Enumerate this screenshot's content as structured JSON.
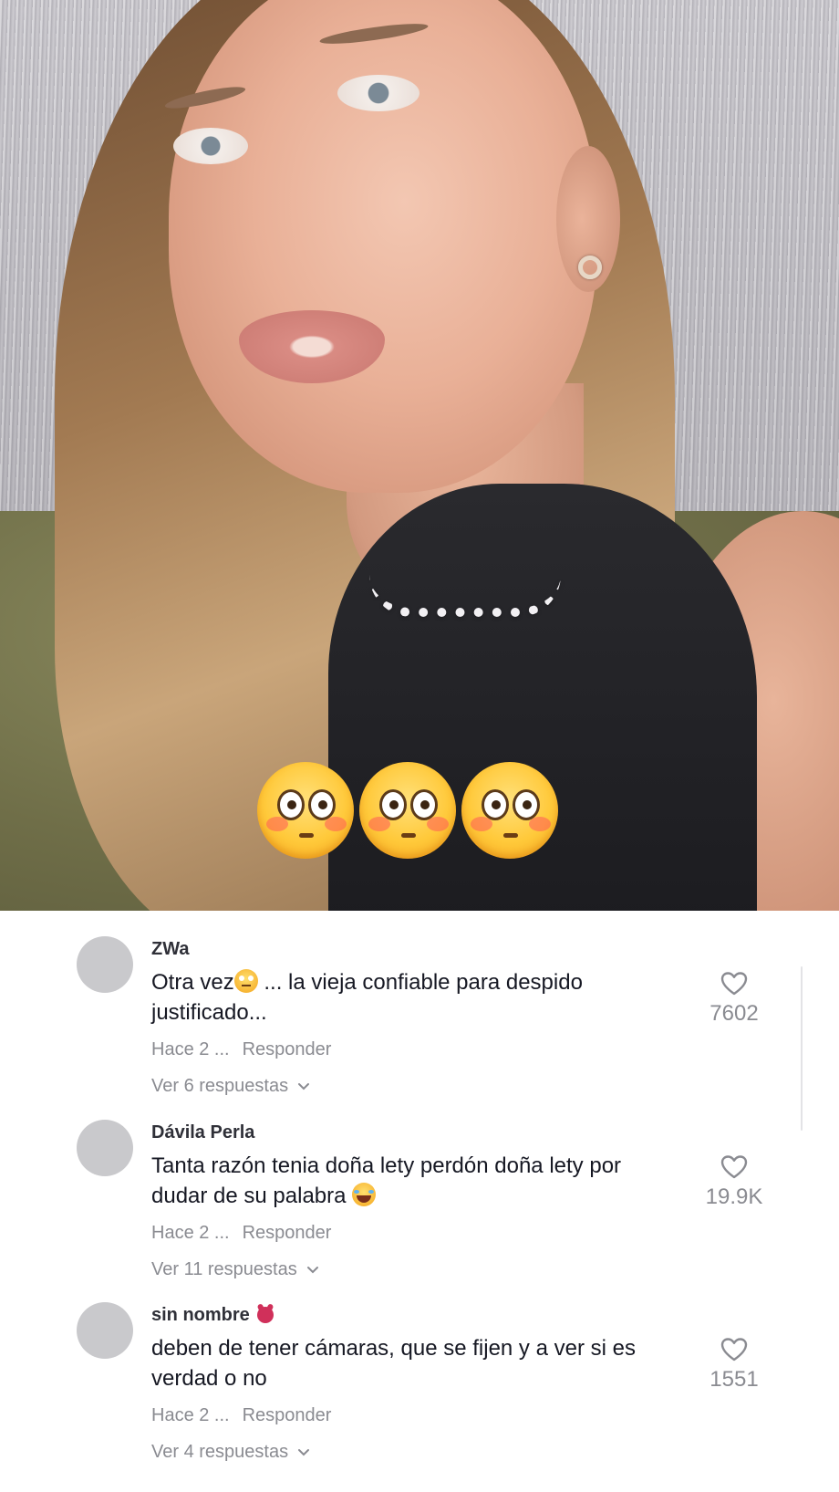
{
  "overlay": {
    "emojis": [
      "flushed-face",
      "flushed-face",
      "flushed-face"
    ]
  },
  "comments": [
    {
      "username": "ZWa",
      "text_before": "Otra vez",
      "emoji": "face-with-rolling-eyes",
      "text_after": "... la vieja confiable para despido justificado...",
      "time": "Hace 2 ...",
      "reply_label": "Responder",
      "view_replies": "Ver 6 respuestas",
      "likes": "7602"
    },
    {
      "username": "Dávila Perla",
      "text_before": "Tanta razón tenia doña lety perdón doña lety por dudar de su palabra",
      "emoji": "face-with-tears-of-joy",
      "text_after": "",
      "time": "Hace 2 ...",
      "reply_label": "Responder",
      "view_replies": "Ver 11 respuestas",
      "likes": "19.9K"
    },
    {
      "username": "sin nombre",
      "badge": "devil-face",
      "text_before": "deben de tener cámaras, que se fijen y a ver si es verdad o no",
      "text_after": "",
      "time": "Hace 2 ...",
      "reply_label": "Responder",
      "view_replies": "Ver 4 respuestas",
      "likes": "1551"
    }
  ],
  "colors": {
    "text": "#161823",
    "secondary": "#8a8b91",
    "avatar": "#c9c9cc"
  }
}
